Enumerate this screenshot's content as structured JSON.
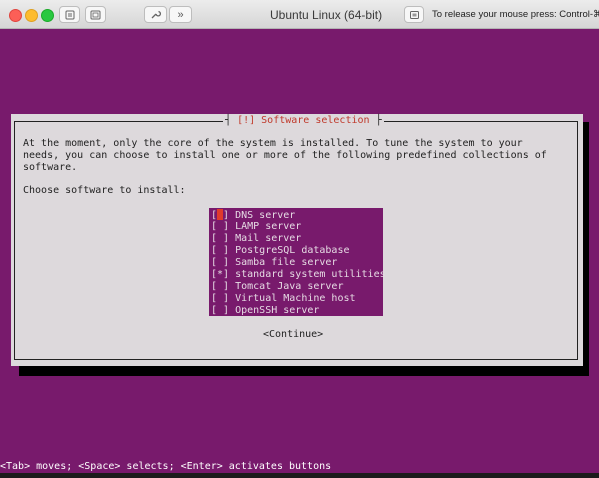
{
  "window": {
    "title": "Ubuntu Linux (64-bit)",
    "release_hint": "To release your mouse press: Control-⌘"
  },
  "dialog": {
    "title": "Software selection",
    "title_prefix": "[!]",
    "description_lines": [
      "At the moment, only the core of the system is installed. To tune the system to your",
      "needs, you can choose to install one or more of the following predefined collections of",
      "software."
    ],
    "choose_label": "Choose software to install:",
    "items": [
      {
        "mark": "[ ]",
        "label": "DNS server",
        "focused": true
      },
      {
        "mark": "[ ]",
        "label": "LAMP server"
      },
      {
        "mark": "[ ]",
        "label": "Mail server"
      },
      {
        "mark": "[ ]",
        "label": "PostgreSQL database"
      },
      {
        "mark": "[ ]",
        "label": "Samba file server"
      },
      {
        "mark": "[*]",
        "label": "standard system utilities"
      },
      {
        "mark": "[ ]",
        "label": "Tomcat Java server"
      },
      {
        "mark": "[ ]",
        "label": "Virtual Machine host"
      },
      {
        "mark": "[ ]",
        "label": "OpenSSH server"
      }
    ],
    "continue_label": "<Continue>"
  },
  "status_line": "<Tab> moves; <Space> selects; <Enter> activates buttons",
  "colors": {
    "background": "#781a6c",
    "dialog": "#ddd9dc",
    "accent_red": "#c0392b"
  }
}
